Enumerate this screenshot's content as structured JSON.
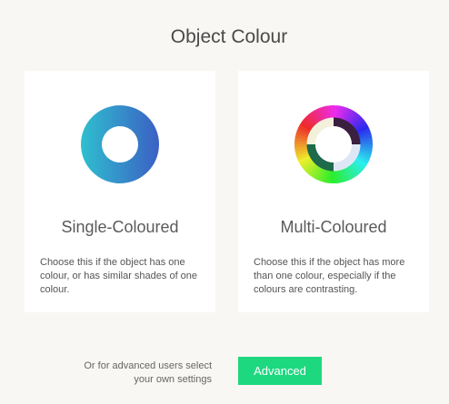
{
  "page": {
    "title": "Object Colour"
  },
  "options": {
    "single": {
      "title": "Single-Coloured",
      "description": "Choose this if the object has one colour, or has similar shades of one colour.",
      "icon": "single-colour-ring-icon"
    },
    "multi": {
      "title": "Multi-Coloured",
      "description": "Choose this if the object has more than one colour, especially if the colours are contrasting.",
      "icon": "multi-colour-ring-icon"
    }
  },
  "footer": {
    "advanced_prompt": "Or for advanced users select your own settings",
    "advanced_button_label": "Advanced"
  },
  "colors": {
    "background": "#f8f7f3",
    "accent": "#1ed880",
    "single_ring_start": "#2fbfcf",
    "single_ring_end": "#3b5fc4"
  }
}
